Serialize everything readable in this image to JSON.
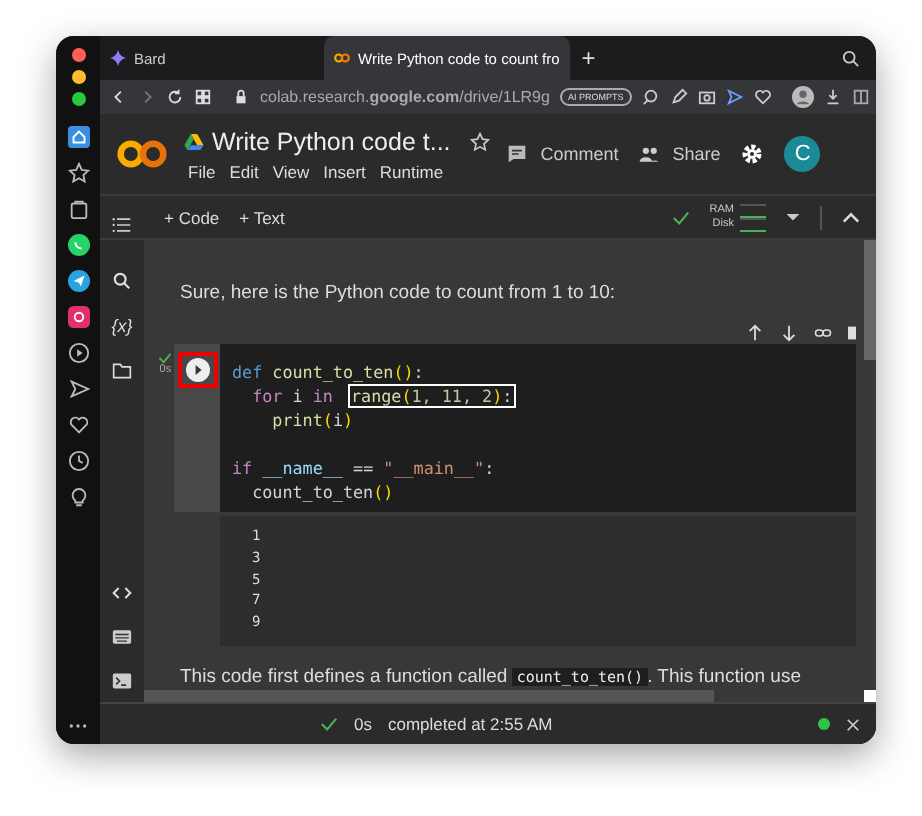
{
  "browser": {
    "tabs": [
      {
        "label": "Bard",
        "selected": false
      },
      {
        "label": "Write Python code to count fro",
        "selected": true
      }
    ],
    "new_tab": "+",
    "url": "colab.research.**google.com**/drive/1LR9g",
    "ai_prompts": "AI PROMPTS"
  },
  "notebook": {
    "title": "Write Python code t...",
    "menu": [
      "File",
      "Edit",
      "View",
      "Insert",
      "Runtime"
    ],
    "comment": "Comment",
    "share": "Share",
    "avatar": "C"
  },
  "toolbar": {
    "add_code": "+ Code",
    "add_text": "+ Text",
    "ram": "RAM",
    "disk": "Disk"
  },
  "sidebar": {
    "variables": "{x}"
  },
  "intro": "Sure, here is the Python code to count from 1 to 10:",
  "cell": {
    "executed": true,
    "exec_time": "0s",
    "blocks": [
      [
        [
          {
            "boxed": false,
            "tokens": [
              {
                "t": "def ",
                "kind": "keyword"
              },
              {
                "t": "count_to_ten",
                "kind": "function"
              },
              {
                "t": "()",
                "kind": "paren"
              },
              {
                "t": ":",
                "kind": "plain"
              }
            ]
          }
        ],
        [
          {
            "boxed": false,
            "tokens": [
              {
                "t": "  for",
                "kind": "control"
              },
              {
                "t": " i ",
                "kind": "plain"
              },
              {
                "t": "in ",
                "kind": "control"
              }
            ]
          },
          {
            "boxed": true,
            "tokens": [
              {
                "t": "range",
                "kind": "function"
              },
              {
                "t": "(",
                "kind": "paren"
              },
              {
                "t": "1, 11, 2",
                "kind": "number"
              },
              {
                "t": ")",
                "kind": "paren"
              },
              {
                "t": ":",
                "kind": "plain"
              }
            ]
          }
        ],
        [
          {
            "boxed": false,
            "tokens": [
              {
                "t": "    print",
                "kind": "function"
              },
              {
                "t": "(",
                "kind": "paren"
              },
              {
                "t": "i",
                "kind": "plain"
              },
              {
                "t": ")",
                "kind": "paren"
              }
            ]
          }
        ]
      ],
      [
        [
          {
            "boxed": false,
            "tokens": [
              {
                "t": "if ",
                "kind": "control"
              },
              {
                "t": "__name__",
                "kind": "variable"
              },
              {
                "t": " == ",
                "kind": "plain"
              },
              {
                "t": "\"__main__\"",
                "kind": "string"
              },
              {
                "t": ":",
                "kind": "plain"
              }
            ]
          }
        ],
        [
          {
            "boxed": false,
            "tokens": [
              {
                "t": "  count_to_ten",
                "kind": "plain"
              },
              {
                "t": "()",
                "kind": "paren"
              }
            ]
          }
        ]
      ]
    ]
  },
  "output": [
    "1",
    "3",
    "5",
    "7",
    "9"
  ],
  "explanation": {
    "before": "This code first defines a function called",
    "code": "count_to_ten()",
    "after": ". This function use"
  },
  "status": {
    "ok": true,
    "time": "0s",
    "message": "completed at 2:55 AM",
    "connected": true
  }
}
